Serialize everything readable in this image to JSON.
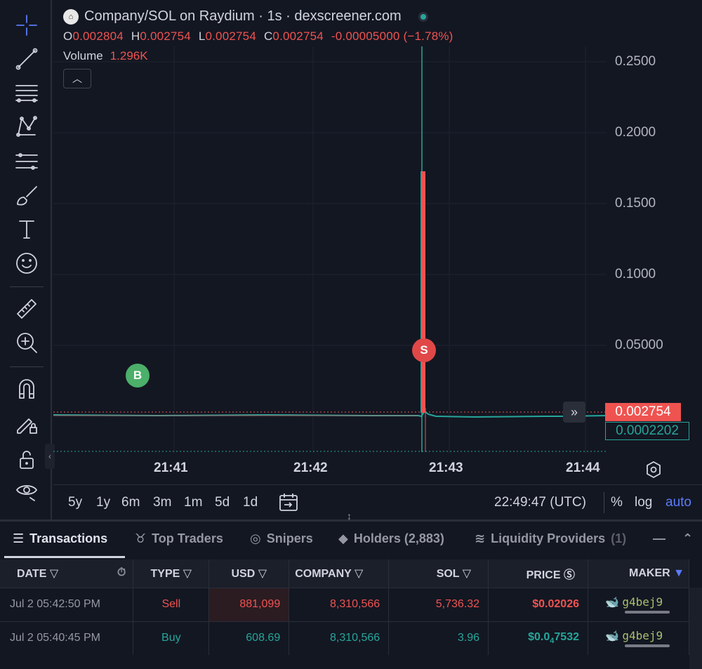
{
  "header": {
    "title": "Company/SOL on Raydium · 1s · dexscreener.com",
    "logo_icon": "bank-icon"
  },
  "ohlc": {
    "o_key": "O",
    "o": "0.002804",
    "h_key": "H",
    "h": "0.002754",
    "l_key": "L",
    "l": "0.002754",
    "c_key": "C",
    "c": "0.002754",
    "change": "-0.00005000 (−1.78%)"
  },
  "volume": {
    "label": "Volume",
    "value": "1.296K"
  },
  "y_ticks": [
    "0.2500",
    "0.2000",
    "0.1500",
    "0.1000",
    "0.05000"
  ],
  "x_ticks": [
    "21:41",
    "21:42",
    "21:43",
    "21:44"
  ],
  "price_tags": {
    "last": "0.002754",
    "other": "0.0002202"
  },
  "markers": {
    "buy": "B",
    "sell": "S"
  },
  "ranges": [
    "5y",
    "1y",
    "6m",
    "3m",
    "1m",
    "5d",
    "1d"
  ],
  "clock": "22:49:47 (UTC)",
  "scale_opts": {
    "percent": "%",
    "log": "log",
    "auto": "auto"
  },
  "tabs": [
    {
      "label": "Transactions",
      "icon": "list-icon"
    },
    {
      "label": "Top Traders",
      "icon": "medal-icon"
    },
    {
      "label": "Snipers",
      "icon": "target-icon"
    },
    {
      "label": "Holders (2,883)",
      "icon": "diamond-icon"
    },
    {
      "label": "Liquidity Providers",
      "count": "(1)",
      "icon": "waves-icon"
    }
  ],
  "table": {
    "headers": [
      "DATE",
      "TYPE",
      "USD",
      "COMPANY",
      "SOL",
      "PRICE",
      "MAKER"
    ],
    "rows": [
      {
        "date": "Jul 2 05:42:50 PM",
        "type": "Sell",
        "usd": "881,099",
        "company": "8,310,566",
        "sol": "5,736.32",
        "price": "$0.02026",
        "maker": "g4bej9"
      },
      {
        "date": "Jul 2 05:40:45 PM",
        "type": "Buy",
        "usd": "608.69",
        "company": "8,310,566",
        "sol": "3.96",
        "price_a": "$0.0",
        "price_sub": "4",
        "price_b": "7532",
        "maker": "g4bej9"
      }
    ]
  },
  "colors": {
    "up": "#26a69a",
    "down": "#ef5350",
    "bg": "#131722",
    "accent": "#5b7cfa"
  }
}
